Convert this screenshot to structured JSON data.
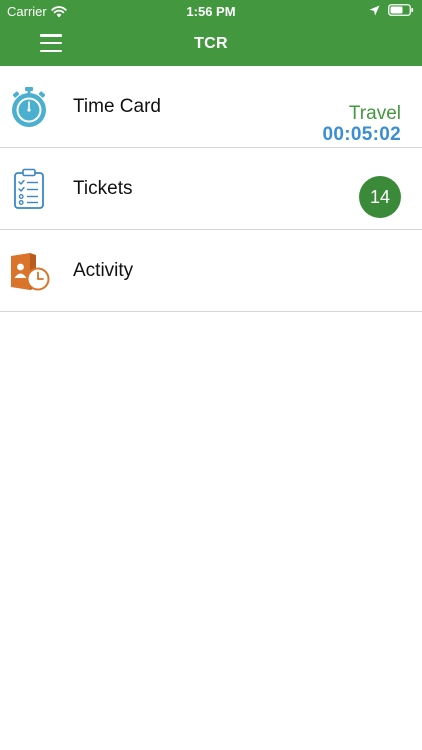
{
  "status_bar": {
    "carrier": "Carrier",
    "time": "1:56 PM",
    "icons": [
      "wifi-icon",
      "location-arrow-icon",
      "battery-icon"
    ]
  },
  "nav": {
    "title": "TCR",
    "menu_icon": "hamburger-menu-icon"
  },
  "items": [
    {
      "label": "Time Card",
      "icon": "stopwatch-icon",
      "status_mode": "Travel",
      "status_timer": "00:05:02"
    },
    {
      "label": "Tickets",
      "icon": "clipboard-checklist-icon",
      "badge": "14"
    },
    {
      "label": "Activity",
      "icon": "activity-clock-icon"
    }
  ],
  "colors": {
    "brand_green": "#43983f",
    "timer_blue": "#3a8fd4",
    "badge_green": "#3a8a3a",
    "activity_orange": "#d9742a"
  }
}
